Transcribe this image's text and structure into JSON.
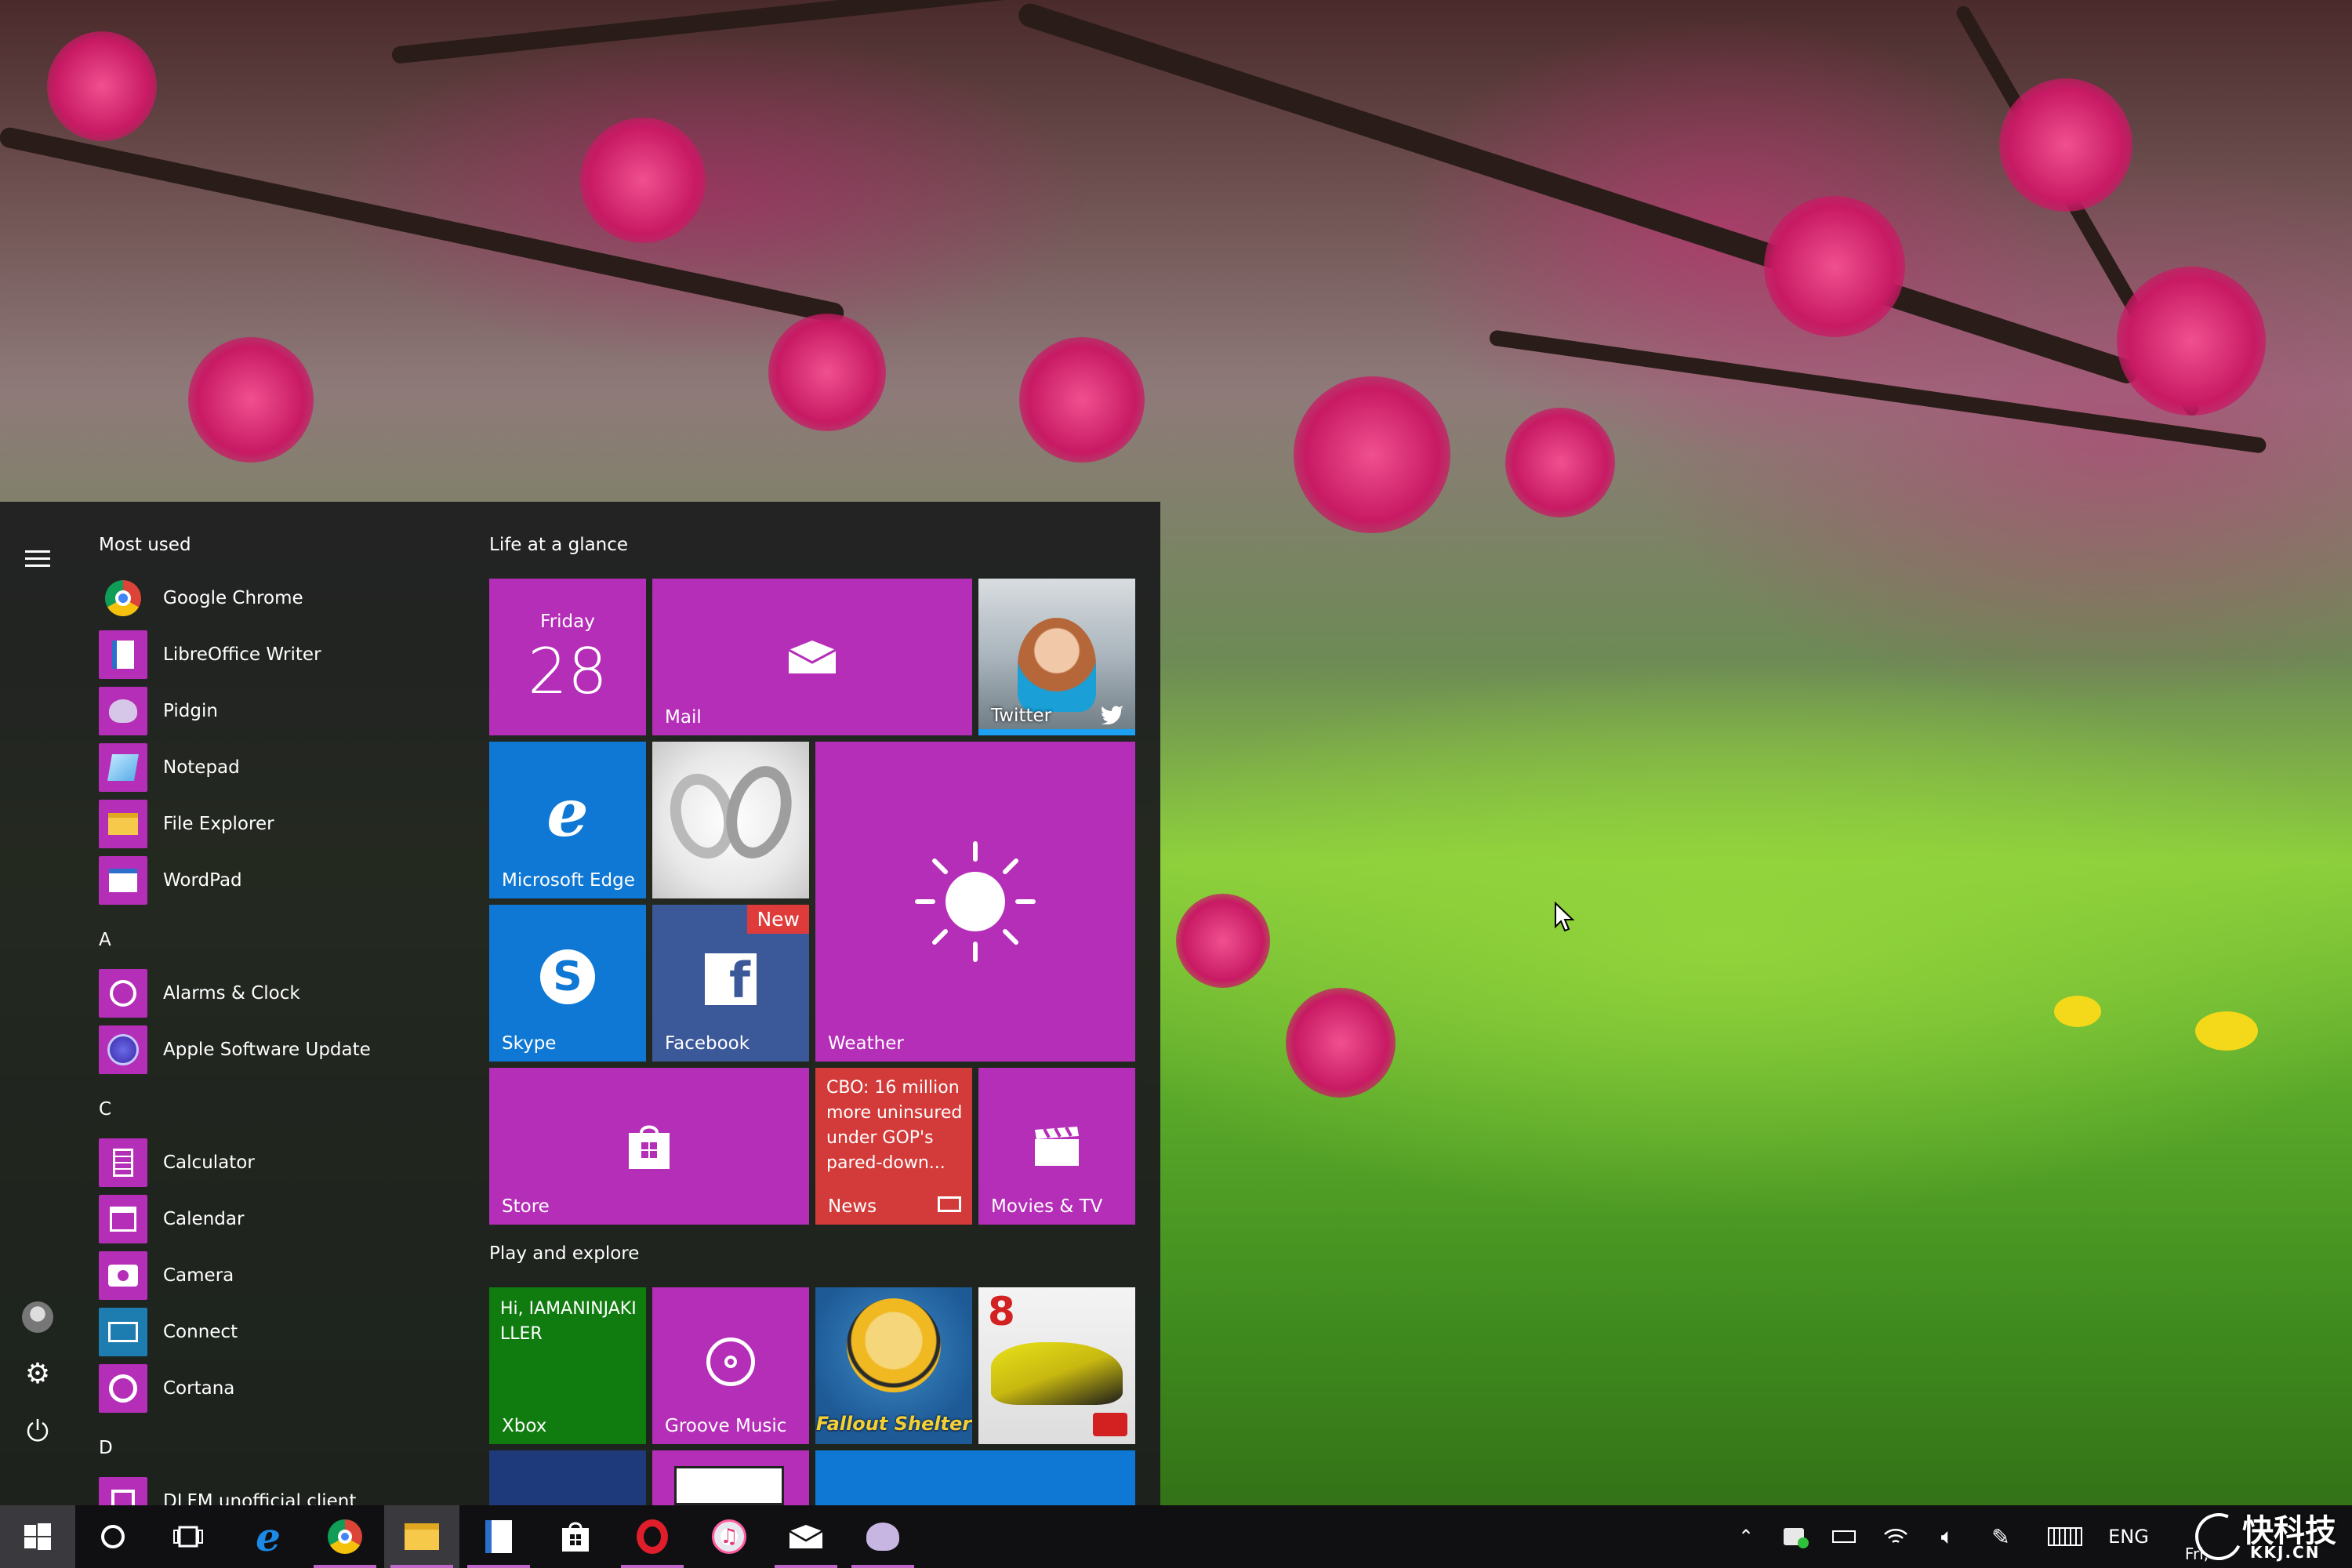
{
  "start_menu": {
    "most_used_heading": "Most used",
    "most_used": [
      {
        "label": "Google Chrome",
        "icon": "chrome-icon"
      },
      {
        "label": "LibreOffice Writer",
        "icon": "libreoffice-writer-icon"
      },
      {
        "label": "Pidgin",
        "icon": "pidgin-icon"
      },
      {
        "label": "Notepad",
        "icon": "notepad-icon"
      },
      {
        "label": "File Explorer",
        "icon": "file-explorer-icon"
      },
      {
        "label": "WordPad",
        "icon": "wordpad-icon"
      }
    ],
    "letter_a": "A",
    "group_a": [
      {
        "label": "Alarms & Clock",
        "icon": "alarm-clock-icon"
      },
      {
        "label": "Apple Software Update",
        "icon": "apple-update-icon"
      }
    ],
    "letter_c": "C",
    "group_c": [
      {
        "label": "Calculator",
        "icon": "calculator-icon"
      },
      {
        "label": "Calendar",
        "icon": "calendar-icon"
      },
      {
        "label": "Camera",
        "icon": "camera-icon"
      },
      {
        "label": "Connect",
        "icon": "connect-icon"
      },
      {
        "label": "Cortana",
        "icon": "cortana-icon"
      }
    ],
    "letter_d": "D",
    "group_d": [
      {
        "label": "DLFM unofficial client",
        "icon": "dlfm-icon"
      }
    ]
  },
  "tiles": {
    "life_heading": "Life at a glance",
    "play_heading": "Play and explore",
    "calendar_day": "Friday",
    "calendar_date": "28",
    "mail": "Mail",
    "twitter": "Twitter",
    "edge": "Microsoft Edge",
    "weather": "Weather",
    "skype": "Skype",
    "facebook": "Facebook",
    "facebook_badge": "New",
    "store": "Store",
    "news_headline": "CBO: 16 million more uninsured under GOP's pared-down...",
    "news": "News",
    "movies": "Movies & TV",
    "xbox_greeting": "Hi, IAMANINJAKILLER",
    "xbox": "Xbox",
    "groove": "Groove Music",
    "fallout": "Fallout Shelter",
    "asphalt_number": "8"
  },
  "taskbar": {
    "language": "ENG",
    "clock_partial": "Fri,",
    "watermark": "快科技",
    "watermark_domain": "KKJ.CN"
  },
  "colors": {
    "accent": "#b52eb8",
    "edge_blue": "#0f78d4",
    "facebook_blue": "#3b5998",
    "news_red": "#d33b3a",
    "xbox_green": "#107c10"
  }
}
